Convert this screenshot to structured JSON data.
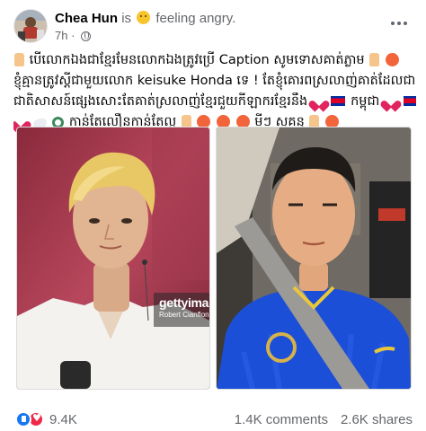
{
  "post": {
    "author": "Chea Hun",
    "is_word": "is",
    "feeling": "feeling angry.",
    "time": "7h",
    "text_lines": [
      "បើលោកឯងជាខ្មែរមែនលោកឯងត្រូវប្រើ Caption សូមទោសគាត់ភ្លាម",
      "ខ្ញុំគ្មានត្រូវស្តីជាមួយលោក keisuke Honda ទេ ! តែខ្ញុំគោរពស្រលាញ់គាត់ដែលជា",
      "ជាតិសាសន៍ផ្សេងសោះតែគាត់ស្រលាញ់ខ្មែរជួយកីឡាករខ្មែរនឹង",
      "កាន់តែលឿនកាន់តែល្អ",
      "មីៗ សុគន្ធ"
    ],
    "inline_words": {
      "line4_tail": "កម្ពុជា"
    }
  },
  "photo_left": {
    "watermark_brand": "gettyima",
    "watermark_credit": "Robert Cianflone"
  },
  "footer": {
    "reaction_count": "9.4K",
    "comments": "1.4K comments",
    "shares": "2.6K shares"
  },
  "icons": {
    "feeling": "angry-face-icon",
    "privacy": "globe-icon",
    "menu": "more-options-icon",
    "like": "like-reaction-icon",
    "love": "love-reaction-icon"
  },
  "colors": {
    "accent": "#1877f2",
    "love": "#f0284a",
    "muted_text": "#65676b",
    "jersey_blue": "#1c4fd8"
  }
}
